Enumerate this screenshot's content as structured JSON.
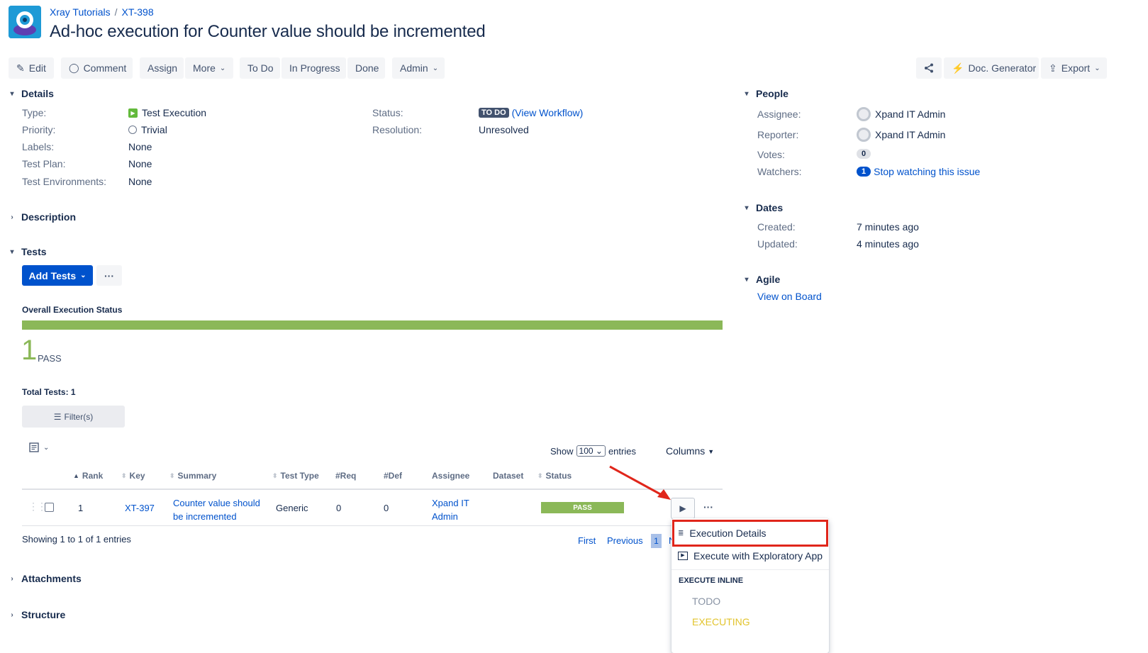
{
  "header": {
    "breadcrumb": [
      "Xray Tutorials",
      "XT-398"
    ],
    "breadcrumb_sep": "/",
    "title": "Ad-hoc execution for Counter value should be incremented"
  },
  "toolbar": {
    "edit": "Edit",
    "comment": "Comment",
    "assign": "Assign",
    "more": "More",
    "todo": "To Do",
    "in_progress": "In Progress",
    "done": "Done",
    "admin": "Admin",
    "doc_generator": "Doc. Generator",
    "export": "Export"
  },
  "details": {
    "heading": "Details",
    "fields": [
      {
        "label": "Type:",
        "value": "Test Execution"
      },
      {
        "label": "Priority:",
        "value": "Trivial"
      },
      {
        "label": "Labels:",
        "value": "None"
      },
      {
        "label": "Test Plan:",
        "value": "None"
      },
      {
        "label": "Test Environments:",
        "value": "None"
      }
    ],
    "status_label": "Status:",
    "status_value": "TO DO",
    "view_workflow": "(View Workflow)",
    "resolution_label": "Resolution:",
    "resolution_value": "Unresolved"
  },
  "description": {
    "heading": "Description"
  },
  "tests": {
    "heading": "Tests",
    "add_tests": "Add Tests",
    "more": "···",
    "overall_label": "Overall Execution Status",
    "pass_fraction": 1.0,
    "pass_count": "1",
    "pass_label": "PASS",
    "total_tests": "Total Tests: 1",
    "filters": "Filter(s)",
    "show": "Show",
    "entries_select": "100",
    "entries": "entries",
    "columns": "Columns",
    "headers": {
      "rank": "Rank",
      "key": "Key",
      "summary": "Summary",
      "test_type": "Test Type",
      "req": "#Req",
      "def": "#Def",
      "assignee": "Assignee",
      "dataset": "Dataset",
      "status": "Status"
    },
    "rows": [
      {
        "rank": "1",
        "key": "XT-397",
        "summary_l1": "Counter value should",
        "summary_l2": "be incremented",
        "test_type": "Generic",
        "req": "0",
        "def": "0",
        "assignee_l1": "Xpand IT",
        "assignee_l2": "Admin",
        "status": "PASS"
      }
    ],
    "showing": "Showing 1 to 1 of 1 entries",
    "pager": {
      "first": "First",
      "previous": "Previous",
      "page": "1",
      "next_partial": "N"
    }
  },
  "attachments": {
    "heading": "Attachments"
  },
  "structure": {
    "heading": "Structure"
  },
  "row_menu": {
    "execution_details": "Execution Details",
    "exploratory": "Execute with Exploratory App",
    "inline_heading": "EXECUTE INLINE",
    "todo": "TODO",
    "executing": "EXECUTING"
  },
  "people": {
    "heading": "People",
    "assignee_label": "Assignee:",
    "assignee": "Xpand IT Admin",
    "reporter_label": "Reporter:",
    "reporter": "Xpand IT Admin",
    "votes_label": "Votes:",
    "votes": "0",
    "watchers_label": "Watchers:",
    "watchers": "1",
    "stop_watching": "Stop watching this issue"
  },
  "dates": {
    "heading": "Dates",
    "created_label": "Created:",
    "created": "7 minutes ago",
    "updated_label": "Updated:",
    "updated": "4 minutes ago"
  },
  "agile": {
    "heading": "Agile",
    "view_on_board": "View on Board"
  },
  "colors": {
    "pass": "#8bb858",
    "primary": "#0052cc",
    "highlight": "#e0261b",
    "executing": "#e2c42d"
  }
}
